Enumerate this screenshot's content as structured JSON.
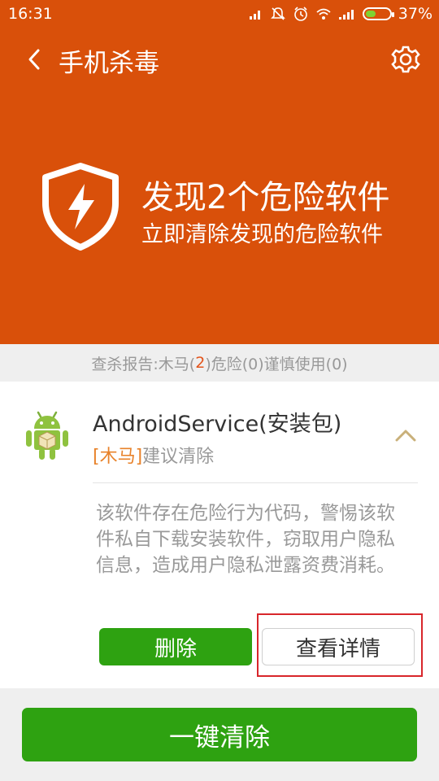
{
  "status": {
    "time": "16:31",
    "battery": "37%",
    "battery_level": 0.37,
    "icons": [
      "signal-icon",
      "mute-icon",
      "alarm-icon",
      "wifi-icon",
      "cellular-icon",
      "battery-icon"
    ]
  },
  "titlebar": {
    "title": "手机杀毒"
  },
  "hero": {
    "headline": "发现2个危险软件",
    "subline": "立即清除发现的危险软件"
  },
  "report": {
    "prefix": "查杀报告:木马(",
    "trojan_count": "2",
    "suffix": ")危险(0)谨慎使用(0)"
  },
  "item": {
    "name": "AndroidService(安装包)",
    "tag": "[木马]",
    "advice": "建议清除",
    "description": "该软件存在危险行为代码，警惕该软件私自下载安装软件，窃取用户隐私信息，造成用户隐私泄露资费消耗。",
    "delete_label": "删除",
    "detail_label": "查看详情"
  },
  "bottom": {
    "clean_all_label": "一键清除"
  },
  "colors": {
    "header_bg": "#d9500a",
    "primary_green": "#2ea211",
    "tag_orange": "#e8822a",
    "highlight_red": "#d8262b"
  }
}
